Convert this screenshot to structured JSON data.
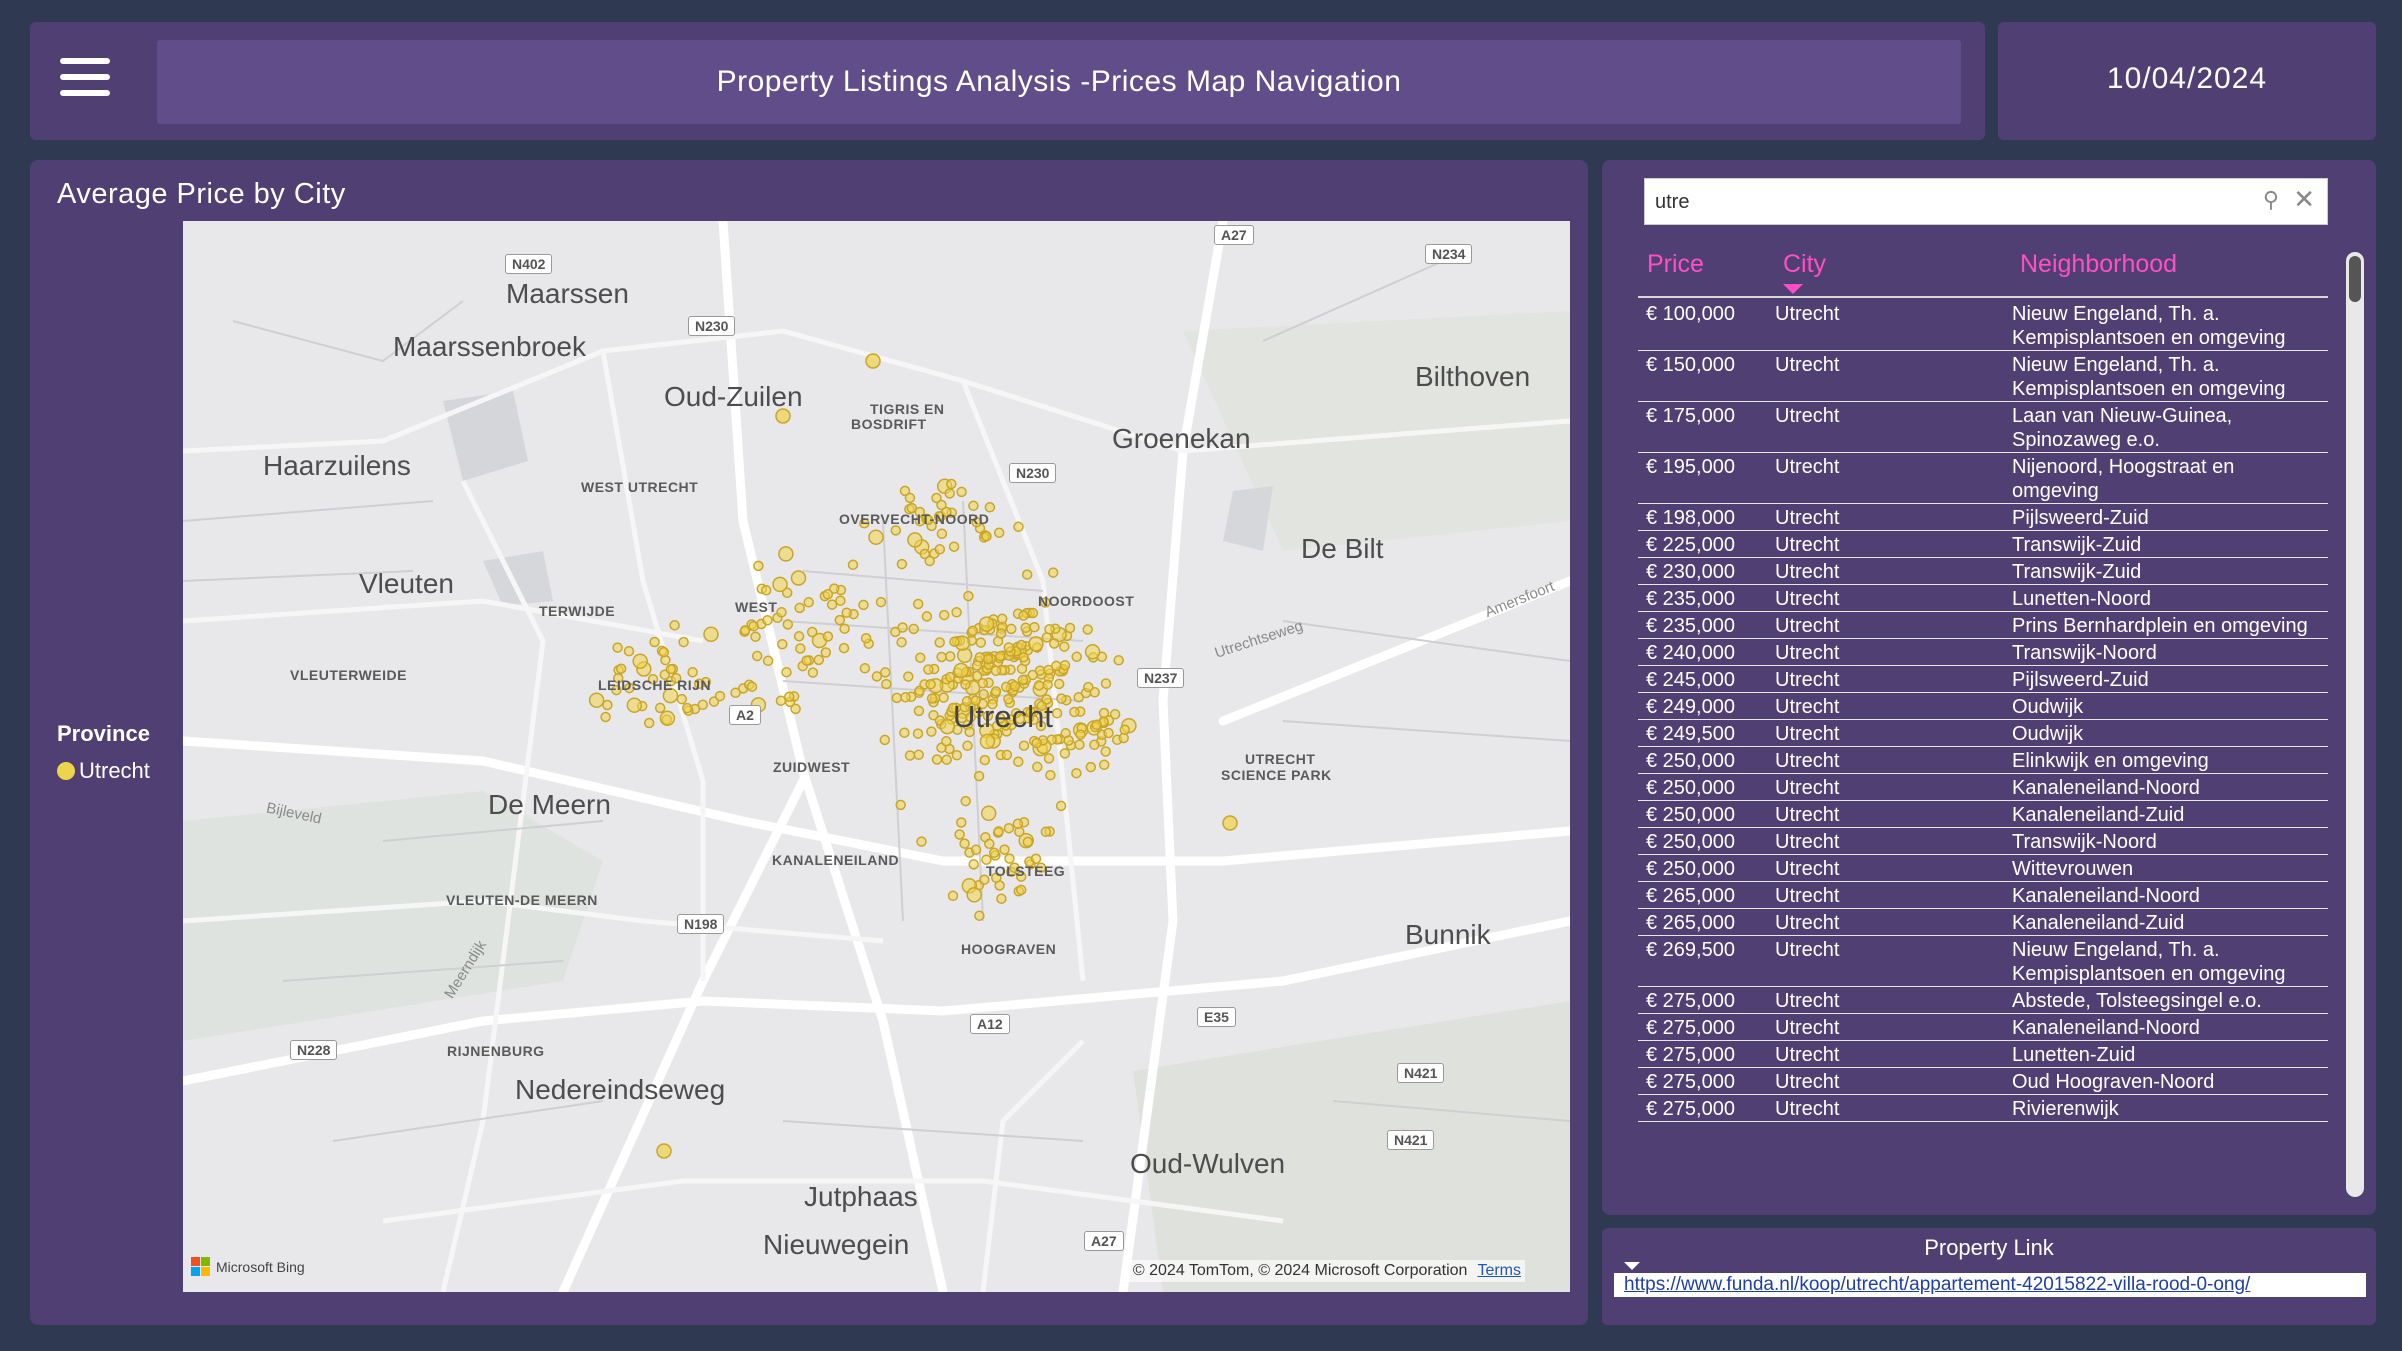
{
  "header": {
    "menu_icon": "hamburger-menu-icon",
    "title": "Property Listings Analysis -Prices Map Navigation",
    "date": "10/04/2024"
  },
  "map_panel": {
    "title": "Average Price by City",
    "legend": {
      "title": "Province",
      "items": [
        {
          "label": "Utrecht",
          "color": "#eed44a"
        }
      ]
    },
    "places": {
      "maarssen": "Maarssen",
      "maarssenbroek": "Maarssenbroek",
      "oud_zuilen": "Oud-Zuilen",
      "groenekan": "Groenekan",
      "bilthoven": "Bilthoven",
      "haarzuilens": "Haarzuilens",
      "vleuten": "Vleuten",
      "de_bilt": "De Bilt",
      "utrecht": "Utrecht",
      "de_meern": "De Meern",
      "bunnik": "Bunnik",
      "nedereindseweg": "Nedereindseweg",
      "oud_wulven": "Oud-Wulven",
      "jutphaas": "Jutphaas",
      "nieuwegein": "Nieuwegein",
      "tigris": "TIGRIS EN",
      "bosdrift": "BOSDRIFT",
      "west_utrecht": "WEST UTRECHT",
      "overvecht_noord": "OVERVECHT-NOORD",
      "terwijde": "TERWIJDE",
      "west": "WEST",
      "noordoost": "NOORDOOST",
      "vleuterweide": "VLEUTERWEIDE",
      "leidsche_rijn": "LEIDSCHE RIJN",
      "zuidwest": "ZUIDWEST",
      "utrecht_science_park_1": "UTRECHT",
      "utrecht_science_park_2": "SCIENCE PARK",
      "kanaleneiland": "KANALENEILAND",
      "tolsteeg": "TOLSTEEG",
      "vleuten_de_meern": "VLEUTEN-DE MEERN",
      "hoograven": "HOOGRAVEN",
      "rijnenburg": "RIJNENBURG"
    },
    "roads": {
      "n402": "N402",
      "a27_top": "A27",
      "n234": "N234",
      "n230_a": "N230",
      "n230_b": "N230",
      "n237": "N237",
      "a2": "A2",
      "n198": "N198",
      "a12": "A12",
      "e35": "E35",
      "n228": "N228",
      "n421_a": "N421",
      "n421_b": "N421",
      "a27_bottom": "A27",
      "utrechtseweg": "Utrechtseweg",
      "amersfoort": "Amersfoort",
      "bijleveld": "Bijleveld",
      "meerndijk": "Meerndijk"
    },
    "attribution": {
      "bing": "Microsoft Bing",
      "copyright": "© 2024 TomTom, © 2024 Microsoft Corporation",
      "terms": "Terms"
    }
  },
  "search": {
    "value": "utre",
    "search_icon": "search-icon",
    "clear_icon": "close-icon"
  },
  "table": {
    "columns": {
      "price": "Price",
      "city": "City",
      "neighborhood": "Neighborhood"
    },
    "sort": {
      "column": "City",
      "direction": "descending"
    },
    "rows": [
      {
        "price": "€ 100,000",
        "city": "Utrecht",
        "neighborhood": "Nieuw Engeland, Th. a. Kempisplantsoen en omgeving"
      },
      {
        "price": "€ 150,000",
        "city": "Utrecht",
        "neighborhood": "Nieuw Engeland, Th. a. Kempisplantsoen en omgeving"
      },
      {
        "price": "€ 175,000",
        "city": "Utrecht",
        "neighborhood": "Laan van Nieuw-Guinea, Spinozaweg e.o."
      },
      {
        "price": "€ 195,000",
        "city": "Utrecht",
        "neighborhood": "Nijenoord, Hoogstraat en omgeving"
      },
      {
        "price": "€ 198,000",
        "city": "Utrecht",
        "neighborhood": "Pijlsweerd-Zuid"
      },
      {
        "price": "€ 225,000",
        "city": "Utrecht",
        "neighborhood": "Transwijk-Zuid"
      },
      {
        "price": "€ 230,000",
        "city": "Utrecht",
        "neighborhood": "Transwijk-Zuid"
      },
      {
        "price": "€ 235,000",
        "city": "Utrecht",
        "neighborhood": "Lunetten-Noord"
      },
      {
        "price": "€ 235,000",
        "city": "Utrecht",
        "neighborhood": "Prins Bernhardplein en omgeving"
      },
      {
        "price": "€ 240,000",
        "city": "Utrecht",
        "neighborhood": "Transwijk-Noord"
      },
      {
        "price": "€ 245,000",
        "city": "Utrecht",
        "neighborhood": "Pijlsweerd-Zuid"
      },
      {
        "price": "€ 249,000",
        "city": "Utrecht",
        "neighborhood": "Oudwijk"
      },
      {
        "price": "€ 249,500",
        "city": "Utrecht",
        "neighborhood": "Oudwijk"
      },
      {
        "price": "€ 250,000",
        "city": "Utrecht",
        "neighborhood": "Elinkwijk en omgeving"
      },
      {
        "price": "€ 250,000",
        "city": "Utrecht",
        "neighborhood": "Kanaleneiland-Noord"
      },
      {
        "price": "€ 250,000",
        "city": "Utrecht",
        "neighborhood": "Kanaleneiland-Zuid"
      },
      {
        "price": "€ 250,000",
        "city": "Utrecht",
        "neighborhood": "Transwijk-Noord"
      },
      {
        "price": "€ 250,000",
        "city": "Utrecht",
        "neighborhood": "Wittevrouwen"
      },
      {
        "price": "€ 265,000",
        "city": "Utrecht",
        "neighborhood": "Kanaleneiland-Noord"
      },
      {
        "price": "€ 265,000",
        "city": "Utrecht",
        "neighborhood": "Kanaleneiland-Zuid"
      },
      {
        "price": "€ 269,500",
        "city": "Utrecht",
        "neighborhood": "Nieuw Engeland, Th. a. Kempisplantsoen en omgeving"
      },
      {
        "price": "€ 275,000",
        "city": "Utrecht",
        "neighborhood": "Abstede, Tolsteegsingel e.o."
      },
      {
        "price": "€ 275,000",
        "city": "Utrecht",
        "neighborhood": "Kanaleneiland-Noord"
      },
      {
        "price": "€ 275,000",
        "city": "Utrecht",
        "neighborhood": "Lunetten-Zuid"
      },
      {
        "price": "€ 275,000",
        "city": "Utrecht",
        "neighborhood": "Oud Hoograven-Noord"
      },
      {
        "price": "€ 275,000",
        "city": "Utrecht",
        "neighborhood": "Rivierenwijk"
      }
    ]
  },
  "property_link": {
    "title": "Property Link",
    "url": "https://www.funda.nl/koop/utrecht/appartement-42015822-villa-rood-0-ong/"
  }
}
